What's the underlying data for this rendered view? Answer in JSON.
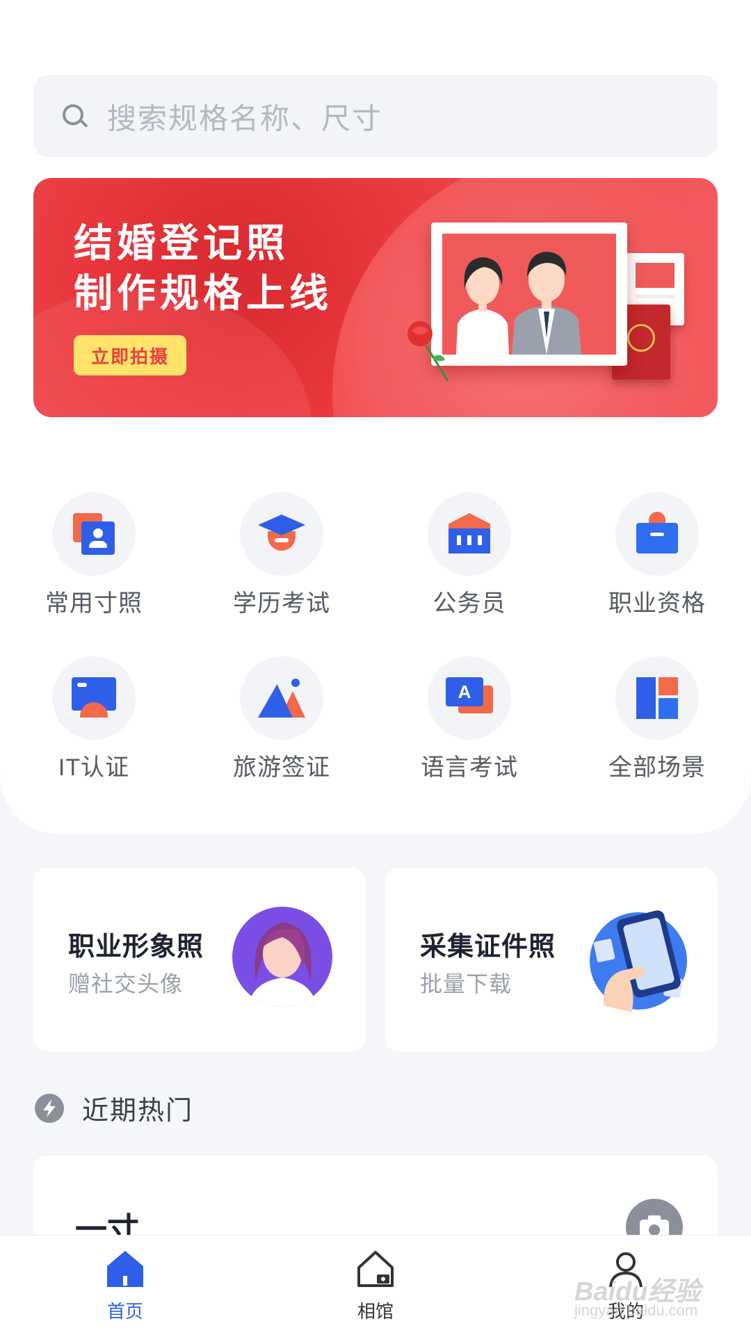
{
  "search": {
    "placeholder": "搜索规格名称、尺寸"
  },
  "banner": {
    "title_line1": "结婚登记照",
    "title_line2": "制作规格上线",
    "button": "立即拍摄"
  },
  "categories": [
    {
      "label": "常用寸照",
      "icon": "portrait-id-icon"
    },
    {
      "label": "学历考试",
      "icon": "graduation-cap-icon"
    },
    {
      "label": "公务员",
      "icon": "government-building-icon"
    },
    {
      "label": "职业资格",
      "icon": "briefcase-icon"
    },
    {
      "label": "IT认证",
      "icon": "monitor-icon"
    },
    {
      "label": "旅游签证",
      "icon": "mountain-icon"
    },
    {
      "label": "语言考试",
      "icon": "language-chat-icon"
    },
    {
      "label": "全部场景",
      "icon": "all-grid-icon"
    }
  ],
  "features": [
    {
      "title": "职业形象照",
      "subtitle": "赠社交头像"
    },
    {
      "title": "采集证件照",
      "subtitle": "批量下载"
    }
  ],
  "hot": {
    "title": "近期热门"
  },
  "hot_list": [
    {
      "title": "一寸"
    }
  ],
  "tabbar": {
    "home": "首页",
    "gallery": "相馆",
    "me": "我的"
  },
  "colors": {
    "accent": "#2f5fe8",
    "banner": "#ee3b40",
    "button": "#ffe36a"
  },
  "watermark": {
    "brand": "Baidu经验",
    "url": "jingyan.baidu.com"
  }
}
